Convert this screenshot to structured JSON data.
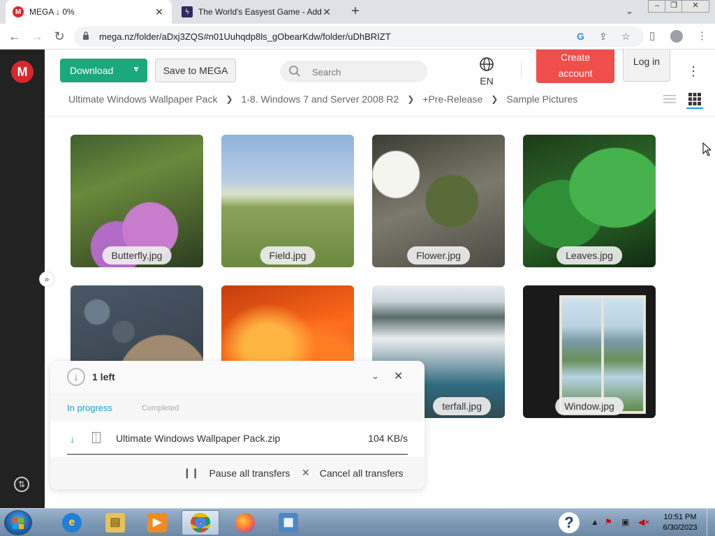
{
  "browser": {
    "tabs": [
      {
        "title": "MEGA ↓ 0%",
        "favicon": "mega-icon",
        "active": true
      },
      {
        "title": "The World's Easyest Game - Addi",
        "favicon": "game-bolt-icon",
        "active": false
      }
    ],
    "url": "mega.nz/folder/aDxj3ZQS#n01Uuhqdp8ls_gObearKdw/folder/uDhBRIZT"
  },
  "header": {
    "download_label": "Download",
    "save_label": "Save to MEGA",
    "search_placeholder": "Search",
    "language": "EN",
    "create_account_line1": "Create",
    "create_account_line2": "account",
    "login_label": "Log in"
  },
  "breadcrumb": [
    "Ultimate Windows Wallpaper Pack",
    "1-8. Windows 7 and Server 2008 R2",
    "+Pre-Release",
    "Sample Pictures"
  ],
  "files": [
    {
      "name": "Butterfly.jpg"
    },
    {
      "name": "Field.jpg"
    },
    {
      "name": "Flower.jpg"
    },
    {
      "name": "Leaves.jpg"
    },
    {
      "name": ""
    },
    {
      "name": ""
    },
    {
      "name": "Waterfall.jpg",
      "visible_text": "terfall.jpg"
    },
    {
      "name": "Window.jpg"
    }
  ],
  "transfers": {
    "count_label": "1 left",
    "tab_in_progress": "In progress",
    "tab_completed": "Completed",
    "items": [
      {
        "name": "Ultimate Windows Wallpaper Pack.zip",
        "speed": "104 KB/s"
      }
    ],
    "pause_all": "Pause all transfers",
    "cancel_all": "Cancel all transfers"
  },
  "taskbar": {
    "apps": [
      "internet-explorer-icon",
      "file-explorer-icon",
      "media-player-icon",
      "chrome-icon",
      "firefox-icon",
      "control-panel-icon"
    ],
    "time": "10:51 PM",
    "date": "6/30/2023"
  },
  "colors": {
    "mega_red": "#d9272e",
    "download_green": "#19a97b",
    "create_red": "#f04e4a",
    "link_blue": "#1a9fd1"
  }
}
